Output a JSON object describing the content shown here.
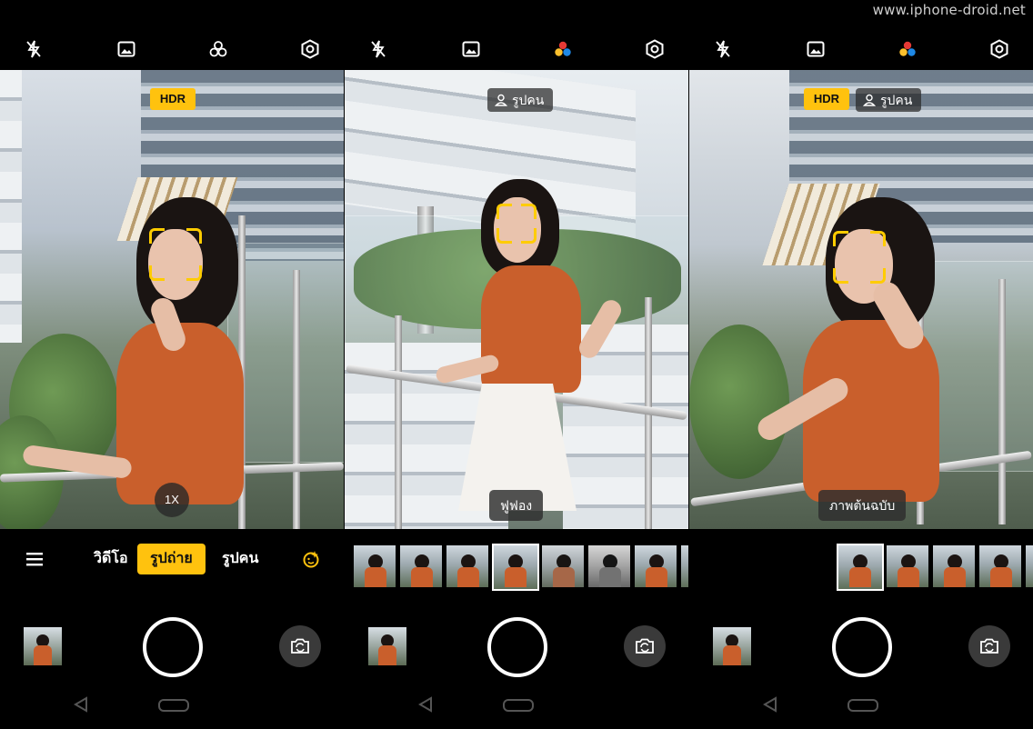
{
  "watermark": "www.iphone-droid.net",
  "icons": {
    "flash": "flash-off-icon",
    "gallery_top": "image-icon",
    "filter": "filter-circles-icon",
    "settings": "settings-ring-icon",
    "menu": "hamburger-menu-icon",
    "beauty": "beauty-camera-icon",
    "flip": "switch-camera-icon",
    "back": "back-triangle-icon",
    "home": "home-pill-icon"
  },
  "colors": {
    "accent": "#ffc20e",
    "filter_dot_red": "#e53935",
    "filter_dot_yellow": "#fbc02d",
    "filter_dot_blue": "#1e88e5"
  },
  "panel1": {
    "hdr_label": "HDR",
    "zoom_label": "1X",
    "modes": [
      "วิดีโอ",
      "รูปถ่าย",
      "รูปคน"
    ],
    "active_mode_index": 1
  },
  "panel2": {
    "portrait_chip": "รูปคน",
    "filter_label": "ฟูฟอง",
    "filter_thumbs_count": 8,
    "selected_thumb_index": 3
  },
  "panel3": {
    "hdr_label": "HDR",
    "portrait_chip": "รูปคน",
    "filter_label": "ภาพต้นฉบับ",
    "selected_thumb_index": 0
  }
}
